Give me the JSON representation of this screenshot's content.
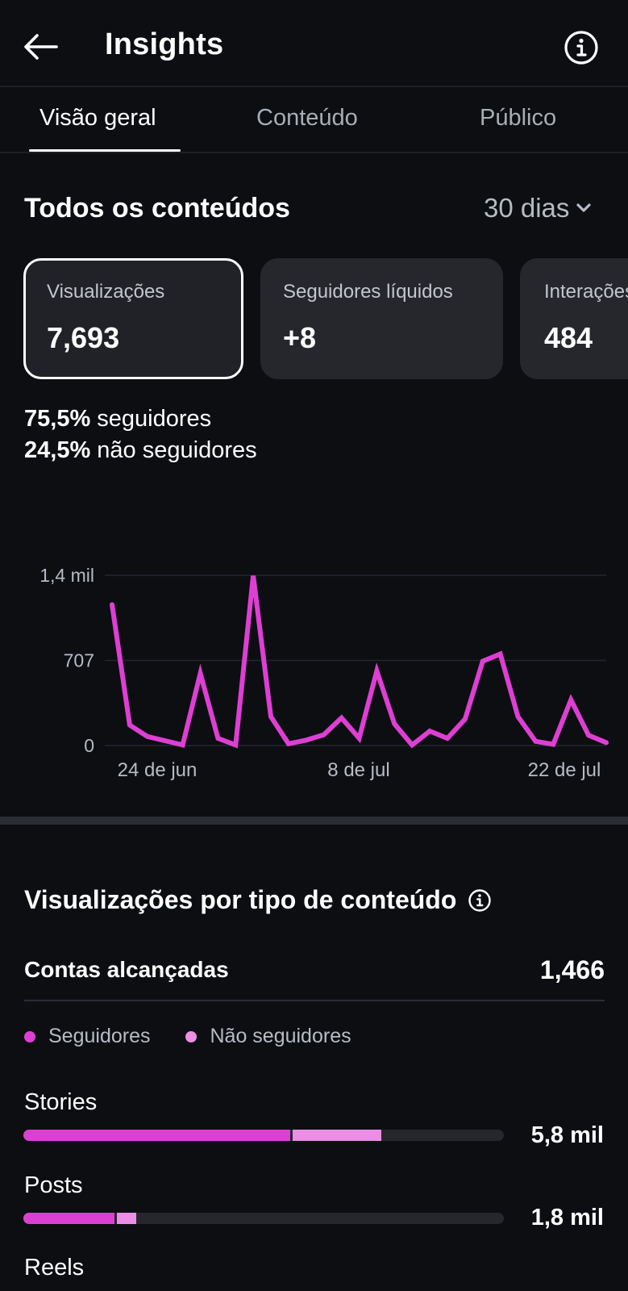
{
  "header": {
    "title": "Insights"
  },
  "tabs": [
    {
      "label": "Visão geral",
      "active": true
    },
    {
      "label": "Conteúdo",
      "active": false
    },
    {
      "label": "Público",
      "active": false
    }
  ],
  "section": {
    "title": "Todos os conteúdos",
    "period": "30 dias"
  },
  "cards": [
    {
      "label": "Visualizações",
      "value": "7,693",
      "selected": true
    },
    {
      "label": "Seguidores líquidos",
      "value": "+8",
      "selected": false
    },
    {
      "label": "Interações",
      "value": "484",
      "selected": false
    }
  ],
  "split": {
    "followers_pct": "75,5%",
    "followers_label": "seguidores",
    "non_followers_pct": "24,5%",
    "non_followers_label": "não seguidores"
  },
  "colors": {
    "accent": "#de3fd3",
    "accent_light": "#ec8ee5",
    "background": "#0c0e12",
    "card": "#25272d"
  },
  "chart_data": {
    "type": "line",
    "title": "",
    "xlabel": "",
    "ylabel": "",
    "yticks": [
      "1,4 mil",
      "707",
      "0"
    ],
    "ytick_values": [
      1414,
      707,
      0
    ],
    "xticks": [
      "24 de jun",
      "8 de jul",
      "22 de jul"
    ],
    "ylim": [
      0,
      1414
    ],
    "grid": true,
    "series": [
      {
        "values": [
          1170,
          170,
          75,
          40,
          5,
          600,
          60,
          5,
          1410,
          240,
          15,
          45,
          90,
          230,
          60,
          620,
          180,
          5,
          120,
          60,
          220,
          700,
          760,
          240,
          35,
          10,
          380,
          85,
          25
        ]
      }
    ]
  },
  "views_by_type": {
    "title": "Visualizações por tipo de conteúdo",
    "reach_label": "Contas alcançadas",
    "reach_value": "1,466",
    "legend": [
      "Seguidores",
      "Não seguidores"
    ],
    "items": [
      {
        "label": "Stories",
        "value": "5,8 mil",
        "followers_frac": 0.555,
        "non_followers_frac": 0.19
      },
      {
        "label": "Posts",
        "value": "1,8 mil",
        "followers_frac": 0.19,
        "non_followers_frac": 0.045
      },
      {
        "label": "Reels"
      }
    ]
  }
}
